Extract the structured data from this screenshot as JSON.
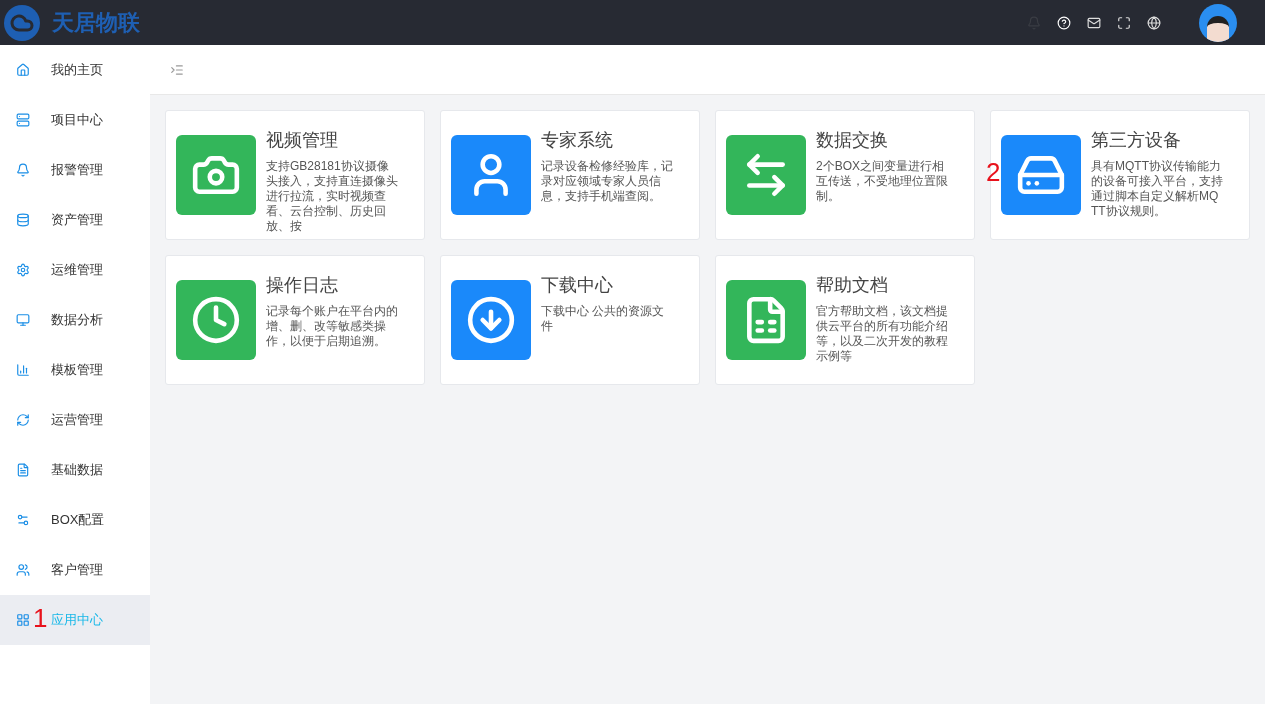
{
  "header": {
    "logo_text": "天居物联"
  },
  "sidebar": {
    "items": [
      {
        "label": "我的主页",
        "selected": false
      },
      {
        "label": "项目中心",
        "selected": false
      },
      {
        "label": "报警管理",
        "selected": false
      },
      {
        "label": "资产管理",
        "selected": false
      },
      {
        "label": "运维管理",
        "selected": false
      },
      {
        "label": "数据分析",
        "selected": false
      },
      {
        "label": "模板管理",
        "selected": false
      },
      {
        "label": "运营管理",
        "selected": false
      },
      {
        "label": "基础数据",
        "selected": false
      },
      {
        "label": "BOX配置",
        "selected": false
      },
      {
        "label": "客户管理",
        "selected": false
      },
      {
        "label": "应用中心",
        "selected": true,
        "marker": "1"
      }
    ]
  },
  "apps": [
    {
      "kind": "camera",
      "color": "#33b65a",
      "title": "视频管理",
      "description": "支持GB28181协议摄像头接入，支持直连摄像头进行拉流，实时视频查看、云台控制、历史回放、按"
    },
    {
      "kind": "person",
      "color": "#1a89fa",
      "title": "专家系统",
      "description": "记录设备检修经验库，记录对应领域专家人员信息，支持手机端查阅。"
    },
    {
      "kind": "swap",
      "color": "#33b65a",
      "title": "数据交换",
      "description": "2个BOX之间变量进行相互传送，不受地理位置限制。"
    },
    {
      "kind": "drive",
      "color": "#1a89fa",
      "title": "第三方设备",
      "description": "具有MQTT协议传输能力的设备可接入平台，支持通过脚本自定义解析MQTT协议规则。",
      "marker": "2"
    },
    {
      "kind": "clock",
      "color": "#33b65a",
      "title": "操作日志",
      "description": "记录每个账户在平台内的增、删、改等敏感类操作，以便于启期追溯。"
    },
    {
      "kind": "download",
      "color": "#1a89fa",
      "title": "下载中心",
      "description": "下载中心 公共的资源文件"
    },
    {
      "kind": "document",
      "color": "#33b65a",
      "title": "帮助文档",
      "description": "官方帮助文档，该文档提供云平台的所有功能介绍等，以及二次开发的教程示例等"
    }
  ]
}
